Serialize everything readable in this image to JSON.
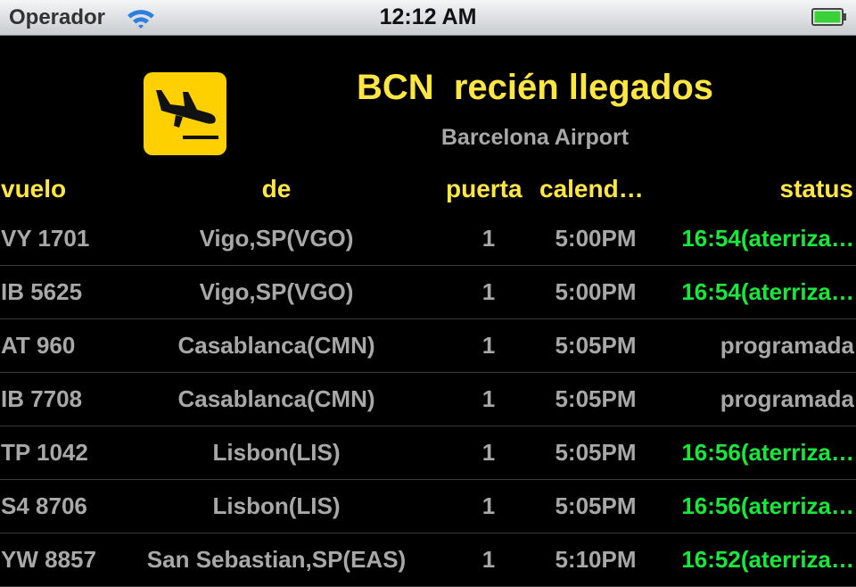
{
  "status_bar": {
    "carrier": "Operador",
    "time": "12:12 AM"
  },
  "header": {
    "title": "BCN  recién llegados",
    "subtitle": "Barcelona Airport"
  },
  "columns": {
    "flight": "vuelo",
    "from": "de",
    "gate": "puerta",
    "scheduled": "calend…",
    "status": "status"
  },
  "colors": {
    "accent_yellow": "#ffe640",
    "icon_yellow": "#ffd000",
    "landed_green": "#17e83a",
    "text_gray": "#a8a8a8"
  },
  "flights": [
    {
      "flight": "VY 1701",
      "from": "Vigo,SP(VGO)",
      "gate": "1",
      "scheduled": "5:00PM",
      "status": "16:54(aterriza…",
      "landed": true
    },
    {
      "flight": "IB 5625",
      "from": "Vigo,SP(VGO)",
      "gate": "1",
      "scheduled": "5:00PM",
      "status": "16:54(aterriza…",
      "landed": true
    },
    {
      "flight": "AT 960",
      "from": "Casablanca(CMN)",
      "gate": "1",
      "scheduled": "5:05PM",
      "status": "programada",
      "landed": false
    },
    {
      "flight": "IB 7708",
      "from": "Casablanca(CMN)",
      "gate": "1",
      "scheduled": "5:05PM",
      "status": "programada",
      "landed": false
    },
    {
      "flight": "TP 1042",
      "from": "Lisbon(LIS)",
      "gate": "1",
      "scheduled": "5:05PM",
      "status": "16:56(aterriza…",
      "landed": true
    },
    {
      "flight": "S4 8706",
      "from": "Lisbon(LIS)",
      "gate": "1",
      "scheduled": "5:05PM",
      "status": "16:56(aterriza…",
      "landed": true
    },
    {
      "flight": "YW 8857",
      "from": "San Sebastian,SP(EAS)",
      "gate": "1",
      "scheduled": "5:10PM",
      "status": "16:52(aterriza…",
      "landed": true
    }
  ]
}
